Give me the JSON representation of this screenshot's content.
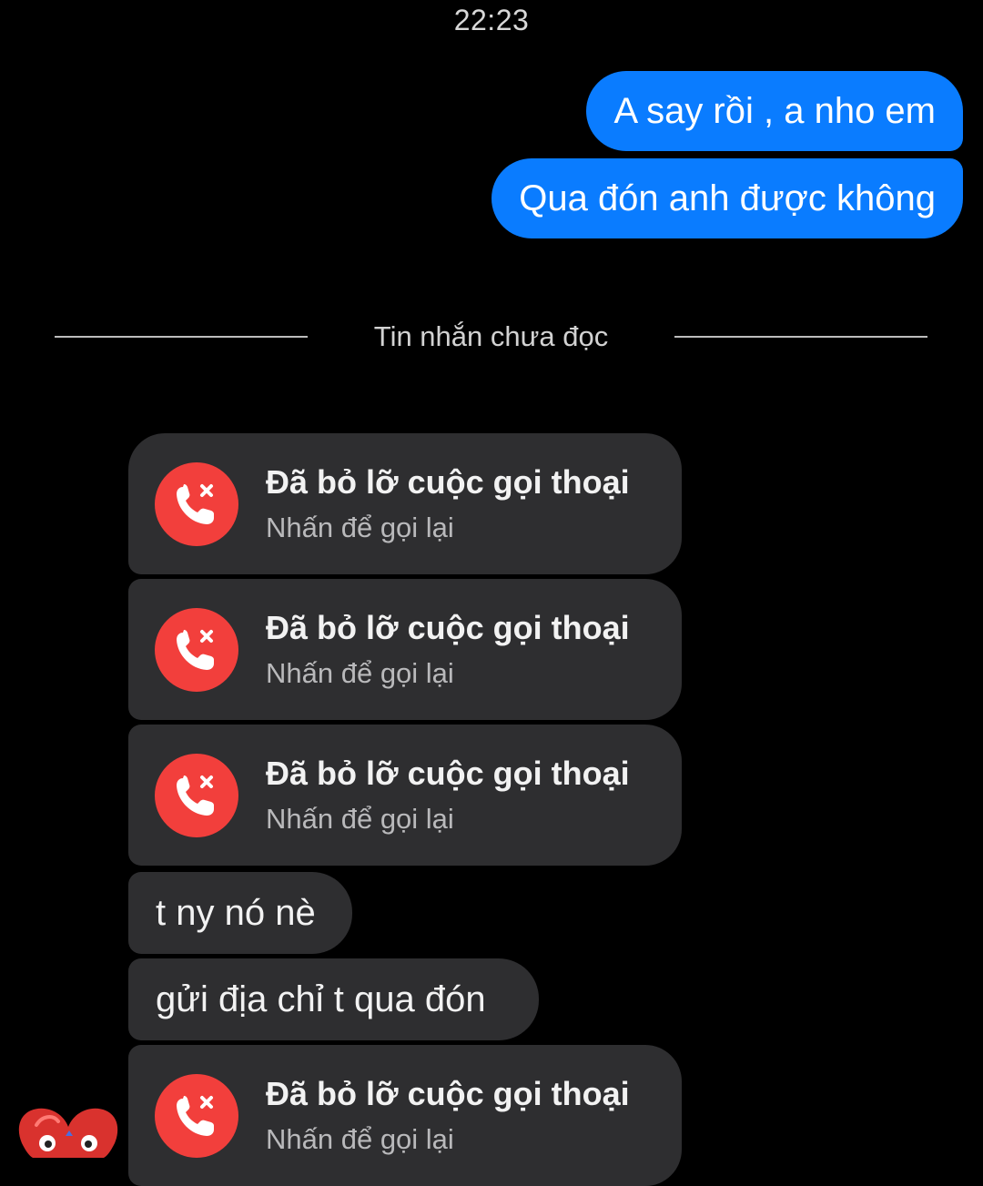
{
  "header": {
    "time": "22:23"
  },
  "outgoing_messages": [
    {
      "text": "A say rồi , a nho em"
    },
    {
      "text": "Qua đón anh được không"
    }
  ],
  "unread_divider": {
    "label": "Tin nhắn chưa đọc"
  },
  "thread": {
    "missed_calls": [
      {
        "title": "Đã bỏ lỡ cuộc gọi thoại",
        "subtitle": "Nhấn để gọi lại",
        "icon": "missed-call-icon"
      },
      {
        "title": "Đã bỏ lỡ cuộc gọi thoại",
        "subtitle": "Nhấn để gọi lại",
        "icon": "missed-call-icon"
      },
      {
        "title": "Đã bỏ lỡ cuộc gọi thoại",
        "subtitle": "Nhấn để gọi lại",
        "icon": "missed-call-icon"
      },
      {
        "title": "Đã bỏ lỡ cuộc gọi thoại",
        "subtitle": "Nhấn để gọi lại",
        "icon": "missed-call-icon"
      }
    ],
    "incoming_messages": [
      {
        "text": "t ny nó nè"
      },
      {
        "text": "gửi địa chỉ t qua đón"
      }
    ]
  },
  "colors": {
    "background": "#000000",
    "outgoing_bubble": "#0a7cff",
    "incoming_bubble": "#2e2e30",
    "missed_call_red": "#f23f3c"
  }
}
